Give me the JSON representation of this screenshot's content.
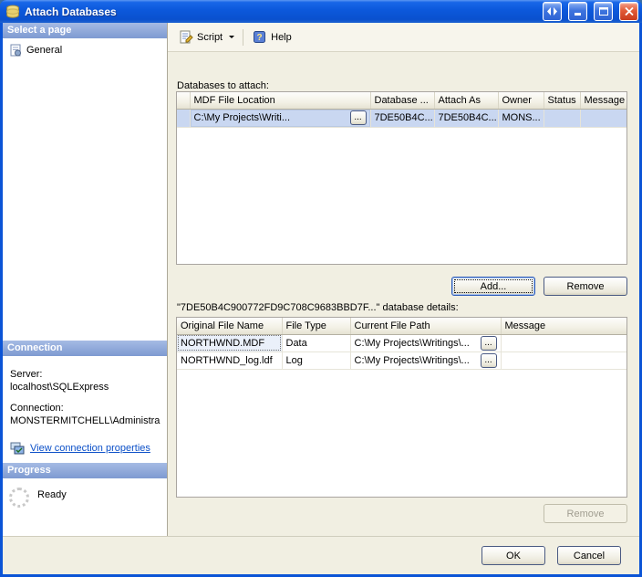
{
  "window": {
    "title": "Attach Databases"
  },
  "sidebar": {
    "select_page_header": "Select a page",
    "general_label": "General",
    "connection_header": "Connection",
    "server_label": "Server:",
    "server_value": "localhost\\SQLExpress",
    "connection_label": "Connection:",
    "connection_value": "MONSTERMITCHELL\\Administra",
    "connection_link": "View connection properties",
    "progress_header": "Progress",
    "progress_status": "Ready"
  },
  "toolbar": {
    "script_label": "Script",
    "help_label": "Help"
  },
  "main": {
    "databases_to_attach_label": "Databases to attach:",
    "attach_grid": {
      "columns": [
        "MDF File Location",
        "Database ...",
        "Attach As",
        "Owner",
        "Status",
        "Message"
      ],
      "rows": [
        {
          "mdf_file_location": "C:\\My Projects\\Writi...",
          "database_name": "7DE50B4C...",
          "attach_as": "7DE50B4C...",
          "owner": "MONS...",
          "status": "",
          "message": ""
        }
      ]
    },
    "add_button": "Add...",
    "remove_button": "Remove",
    "details_label": "\"7DE50B4C900772FD9C708C9683BBD7F...\" database details:",
    "details_grid": {
      "columns": [
        "Original File Name",
        "File Type",
        "Current File Path",
        "Message"
      ],
      "rows": [
        {
          "original_file_name": "NORTHWND.MDF",
          "file_type": "Data",
          "current_file_path": "C:\\My Projects\\Writings\\...",
          "message": ""
        },
        {
          "original_file_name": "NORTHWND_log.ldf",
          "file_type": "Log",
          "current_file_path": "C:\\My Projects\\Writings\\...",
          "message": ""
        }
      ]
    },
    "details_remove_button": "Remove",
    "ellipsis": "..."
  },
  "footer": {
    "ok_button": "OK",
    "cancel_button": "Cancel"
  },
  "icons": {
    "help_glyph": "?"
  },
  "colors": {
    "titlebar_blue": "#0A50CE",
    "selected_row": "#C9D7F1",
    "link_blue": "#0C50C8"
  }
}
